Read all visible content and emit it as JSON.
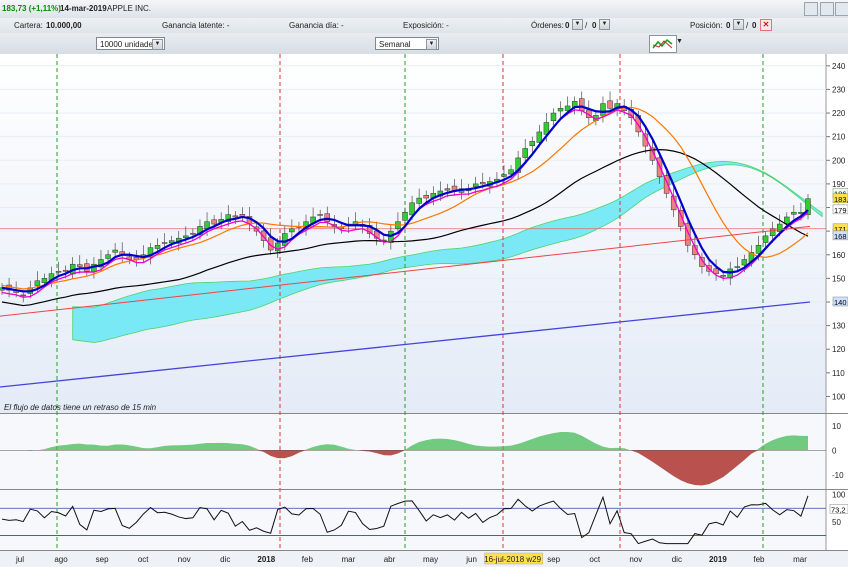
{
  "header": {
    "price": "183,73 (+1,11%)",
    "date": "14-mar-2019",
    "instrument": "APPLE INC."
  },
  "account": {
    "cartera_label": "Cartera:",
    "cartera_value": "10.000,00",
    "ganancia_latente_label": "Ganancia latente: -",
    "ganancia_dia_label": "Ganancia día: -",
    "exposicion_label": "Exposición: -",
    "ordenes_label": "Órdenes:",
    "ordenes_a": "0",
    "ordenes_b": "0",
    "posicion_label": "Posición:",
    "posicion_a": "0",
    "posicion_b": "0"
  },
  "toolbar": {
    "quantity": "10000 unidades",
    "period": "Semanal"
  },
  "notice": "El flujo de datos tiene un retraso de 15 min",
  "colors": {
    "up_candle": "#33cc33",
    "down_candle": "#f08080",
    "ma_fast": "#0000cc",
    "ma_pink": "#ee00cc",
    "ma_orange": "#ff7700",
    "ma_black": "#000000",
    "ma_long": "#4444dd",
    "trendline": "#ee4444",
    "cloud": "#66e8f5"
  },
  "chart_data": [
    {
      "type": "candlestick",
      "title": "",
      "ylim": [
        93,
        245
      ],
      "y_ticks": [
        "240",
        "230",
        "220",
        "210",
        "200",
        "190",
        "180",
        "170",
        "160",
        "150",
        "140",
        "130",
        "120",
        "110",
        "100"
      ],
      "last_value_labels": [
        "186",
        "183,7",
        "179",
        "171",
        "168",
        "140"
      ],
      "reference_level": 171,
      "x_labels": [
        "jul",
        "ago",
        "sep",
        "oct",
        "nov",
        "dic",
        "2018",
        "feb",
        "mar",
        "abr",
        "may",
        "jun",
        "16-jul-2018 w29",
        "sep",
        "oct",
        "nov",
        "dic",
        "2019",
        "feb",
        "mar"
      ],
      "closes": [
        146,
        145,
        144,
        143,
        146,
        149,
        150,
        152,
        153,
        153,
        156,
        155,
        153,
        156,
        158,
        160,
        162,
        160,
        158,
        158,
        160,
        163,
        164,
        165,
        166,
        167,
        168,
        169,
        172,
        174,
        173,
        175,
        177,
        176,
        176,
        173,
        170,
        166,
        162,
        165,
        169,
        171,
        172,
        174,
        176,
        177,
        174,
        172,
        171,
        173,
        174,
        172,
        169,
        167,
        166,
        170,
        174,
        178,
        182,
        184,
        184,
        186,
        187,
        188,
        187,
        188,
        188,
        190,
        190,
        191,
        192,
        194,
        196,
        201,
        205,
        208,
        212,
        216,
        220,
        222,
        223,
        225,
        221,
        218,
        219,
        224,
        222,
        224,
        221,
        218,
        212,
        206,
        200,
        193,
        186,
        179,
        172,
        164,
        160,
        155,
        153,
        152,
        151,
        154,
        155,
        158,
        161,
        164,
        168,
        171,
        173,
        176,
        178,
        178,
        183.73
      ],
      "series": [
        {
          "name": "",
          "color": "#0000cc"
        },
        {
          "name": "",
          "color": "#ee00cc"
        },
        {
          "name": "",
          "color": "#ff7700"
        },
        {
          "name": "",
          "color": "#000000"
        },
        {
          "name": "",
          "color": "#4444dd"
        }
      ]
    },
    {
      "type": "area",
      "title": "",
      "ylim": [
        -15,
        14
      ],
      "y_ticks": [
        "10",
        "0",
        "-10"
      ]
    },
    {
      "type": "line",
      "title": "",
      "ylim": [
        0,
        105
      ],
      "y_ticks": [
        "100",
        "50"
      ],
      "last_value_label": "73,2",
      "overbought": 75,
      "oversold": 25
    }
  ]
}
